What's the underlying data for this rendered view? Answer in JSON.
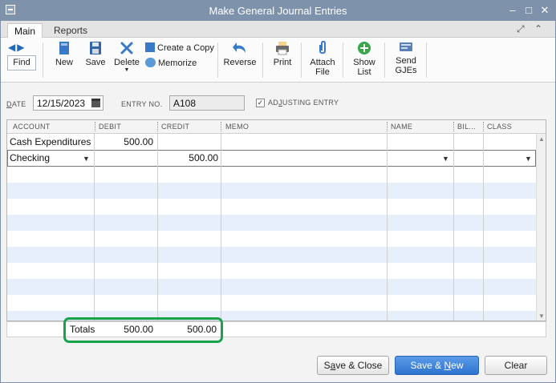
{
  "window": {
    "title": "Make General Journal Entries"
  },
  "tabs": [
    {
      "label": "Main",
      "active": true
    },
    {
      "label": "Reports",
      "active": false
    }
  ],
  "toolbar": {
    "find": "Find",
    "new": "New",
    "save": "Save",
    "delete": "Delete",
    "create_copy": "Create a Copy",
    "memorize": "Memorize",
    "reverse": "Reverse",
    "print": "Print",
    "attach_1": "Attach",
    "attach_2": "File",
    "show_1": "Show",
    "show_2": "List",
    "send_1": "Send",
    "send_2": "GJEs"
  },
  "form": {
    "date_label_u": "D",
    "date_label_rest": "ATE",
    "date_value": "12/15/2023",
    "entry_label": "ENTRY NO.",
    "entry_value": "A108",
    "adjusting_pre": "AD",
    "adjusting_u": "J",
    "adjusting_post": "USTING ENTRY",
    "adjusting_checked": true,
    "adjusting_check_glyph": "✓"
  },
  "grid": {
    "columns": [
      "ACCOUNT",
      "DEBIT",
      "CREDIT",
      "MEMO",
      "NAME",
      "BIL...",
      "CLASS"
    ],
    "rows": [
      {
        "account": "Cash Expenditures",
        "debit": "500.00",
        "credit": ""
      },
      {
        "account": "Checking",
        "debit": "",
        "credit": "500.00"
      }
    ]
  },
  "totals": {
    "label": "Totals",
    "debit": "500.00",
    "credit": "500.00"
  },
  "buttons": {
    "save_close_pre": "S",
    "save_close_u": "a",
    "save_close_post": "ve & Close",
    "save_new_pre": "Save & ",
    "save_new_u": "N",
    "save_new_post": "ew",
    "clear": "Clear"
  },
  "colors": {
    "title_bar": "#7f92ab",
    "row_alt": "#e7effa",
    "highlight": "#17a34a",
    "primary": "#2f73cf"
  }
}
